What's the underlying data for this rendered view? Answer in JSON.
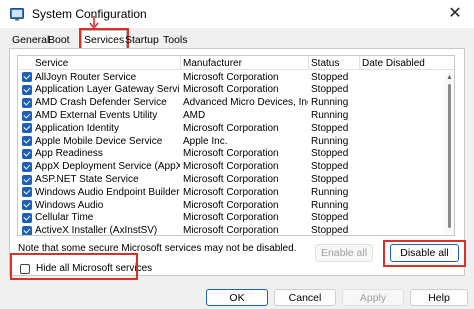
{
  "window": {
    "title": "System Configuration",
    "close_glyph": "✕"
  },
  "tabs": [
    "General",
    "Boot",
    "Services",
    "Startup",
    "Tools"
  ],
  "columns": [
    "Service",
    "Manufacturer",
    "Status",
    "Date Disabled"
  ],
  "services": [
    {
      "name": "AllJoyn Router Service",
      "manufacturer": "Microsoft Corporation",
      "status": "Stopped",
      "date_disabled": ""
    },
    {
      "name": "Application Layer Gateway Service",
      "manufacturer": "Microsoft Corporation",
      "status": "Stopped",
      "date_disabled": ""
    },
    {
      "name": "AMD Crash Defender Service",
      "manufacturer": "Advanced Micro Devices, Inc.",
      "status": "Running",
      "date_disabled": ""
    },
    {
      "name": "AMD External Events Utility",
      "manufacturer": "AMD",
      "status": "Running",
      "date_disabled": ""
    },
    {
      "name": "Application Identity",
      "manufacturer": "Microsoft Corporation",
      "status": "Stopped",
      "date_disabled": ""
    },
    {
      "name": "Apple Mobile Device Service",
      "manufacturer": "Apple Inc.",
      "status": "Running",
      "date_disabled": ""
    },
    {
      "name": "App Readiness",
      "manufacturer": "Microsoft Corporation",
      "status": "Stopped",
      "date_disabled": ""
    },
    {
      "name": "AppX Deployment Service (AppXS...",
      "manufacturer": "Microsoft Corporation",
      "status": "Stopped",
      "date_disabled": ""
    },
    {
      "name": "ASP.NET State Service",
      "manufacturer": "Microsoft Corporation",
      "status": "Stopped",
      "date_disabled": ""
    },
    {
      "name": "Windows Audio Endpoint Builder",
      "manufacturer": "Microsoft Corporation",
      "status": "Running",
      "date_disabled": ""
    },
    {
      "name": "Windows Audio",
      "manufacturer": "Microsoft Corporation",
      "status": "Running",
      "date_disabled": ""
    },
    {
      "name": "Cellular Time",
      "manufacturer": "Microsoft Corporation",
      "status": "Stopped",
      "date_disabled": ""
    },
    {
      "name": "ActiveX Installer (AxInstSV)",
      "manufacturer": "Microsoft Corporation",
      "status": "Stopped",
      "date_disabled": ""
    }
  ],
  "note": "Note that some secure Microsoft services may not be disabled.",
  "hide_ms_label": "Hide all Microsoft services",
  "hide_ms_checked": false,
  "buttons": {
    "enable_all": "Enable all",
    "disable_all": "Disable all",
    "ok": "OK",
    "cancel": "Cancel",
    "apply": "Apply",
    "help": "Help"
  },
  "colors": {
    "highlight": "#d9302c",
    "checkbox": "#1f5fb4"
  }
}
